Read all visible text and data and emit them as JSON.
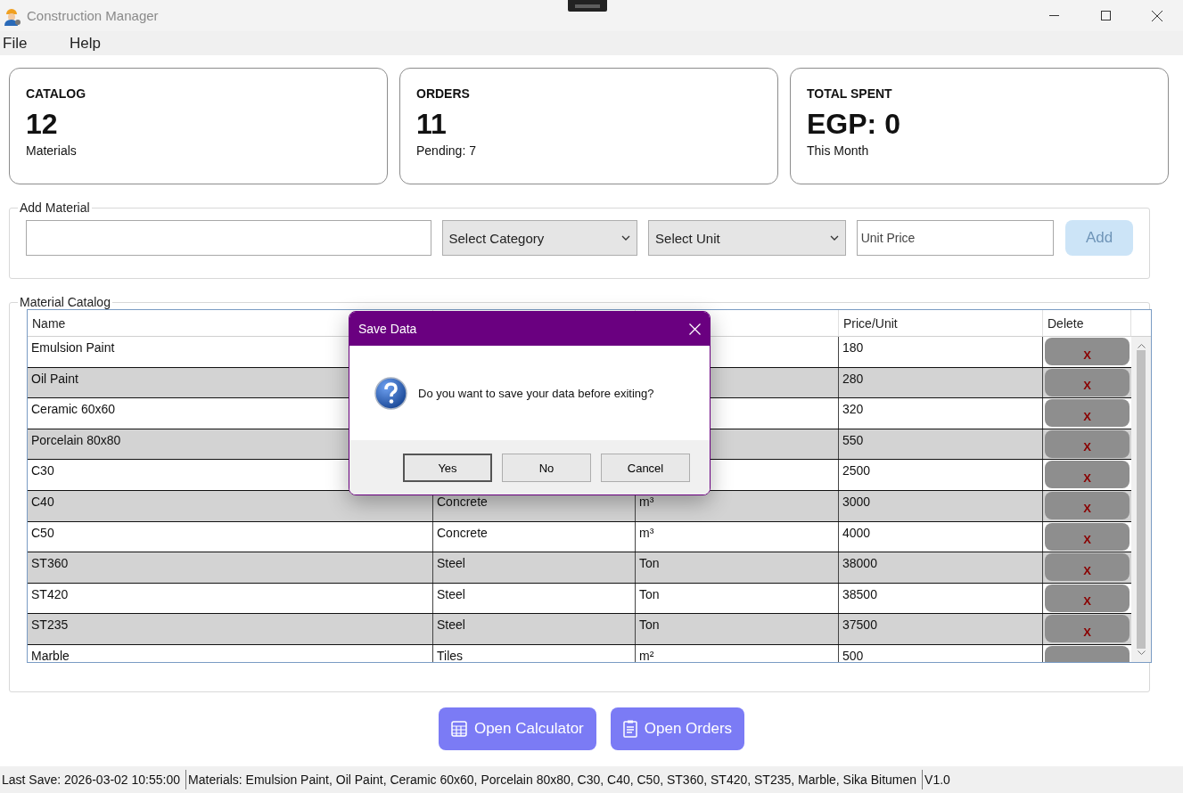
{
  "window": {
    "title": "Construction Manager"
  },
  "menu": [
    "File",
    "Help"
  ],
  "cards": [
    {
      "title": "CATALOG",
      "value": "12",
      "caption": "Materials"
    },
    {
      "title": "ORDERS",
      "value": "11",
      "caption": "Pending: 7"
    },
    {
      "title": "TOTAL SPENT",
      "value": "EGP: 0",
      "caption": "This Month"
    }
  ],
  "add_material": {
    "title": "Add Material",
    "category": {
      "value": "Select Category"
    },
    "unit": {
      "value": "Select Unit"
    },
    "price_field": {
      "placeholder": "Unit Price"
    },
    "add_button": {
      "label": "Add",
      "disabled": true
    }
  },
  "catalog": {
    "title": "Material Catalog",
    "columns": {
      "name": "Name",
      "price": "Price/Unit",
      "delete": "Delete"
    },
    "rows": [
      {
        "name": "Emulsion Paint",
        "price": "180",
        "delete": "X"
      },
      {
        "name": "Oil Paint",
        "price": "280",
        "delete": "X"
      },
      {
        "name": "Ceramic 60x60",
        "price": "320",
        "delete": "X"
      },
      {
        "name": "Porcelain 80x80",
        "price": "550",
        "delete": "X"
      },
      {
        "name": "C30",
        "price": "2500",
        "delete": "X"
      },
      {
        "name": "C40",
        "category": "Concrete",
        "unit": "m³",
        "price": "3000",
        "delete": "X"
      },
      {
        "name": "C50",
        "category": "Concrete",
        "unit": "m³",
        "price": "4000",
        "delete": "X"
      },
      {
        "name": "ST360",
        "category": "Steel",
        "unit": "Ton",
        "price": "38000",
        "delete": "X"
      },
      {
        "name": "ST420",
        "category": "Steel",
        "unit": "Ton",
        "price": "38500",
        "delete": "X"
      },
      {
        "name": "ST235",
        "category": "Steel",
        "unit": "Ton",
        "price": "37500",
        "delete": "X"
      },
      {
        "name": "Marble",
        "category": "Tiles",
        "unit": "m²",
        "price": "500"
      }
    ]
  },
  "actions": [
    {
      "kind": "calculator",
      "label": "Open Calculator"
    },
    {
      "kind": "orders",
      "label": "Open Orders"
    }
  ],
  "status_bar": [
    "Last Save: 2026-03-02 10:55:00",
    "Materials: Emulsion Paint, Oil Paint, Ceramic 60x60, Porcelain 80x80, C30, C40, C50, ST360, ST420, ST235, Marble, Sika Bitumen",
    "V1.0"
  ],
  "dialog": {
    "title": "Save Data",
    "message": "Do you want to save your data before exiting?",
    "buttons": [
      {
        "label": "Yes",
        "default": true
      },
      {
        "label": "No",
        "default": false
      },
      {
        "label": "Cancel",
        "default": false
      }
    ]
  }
}
